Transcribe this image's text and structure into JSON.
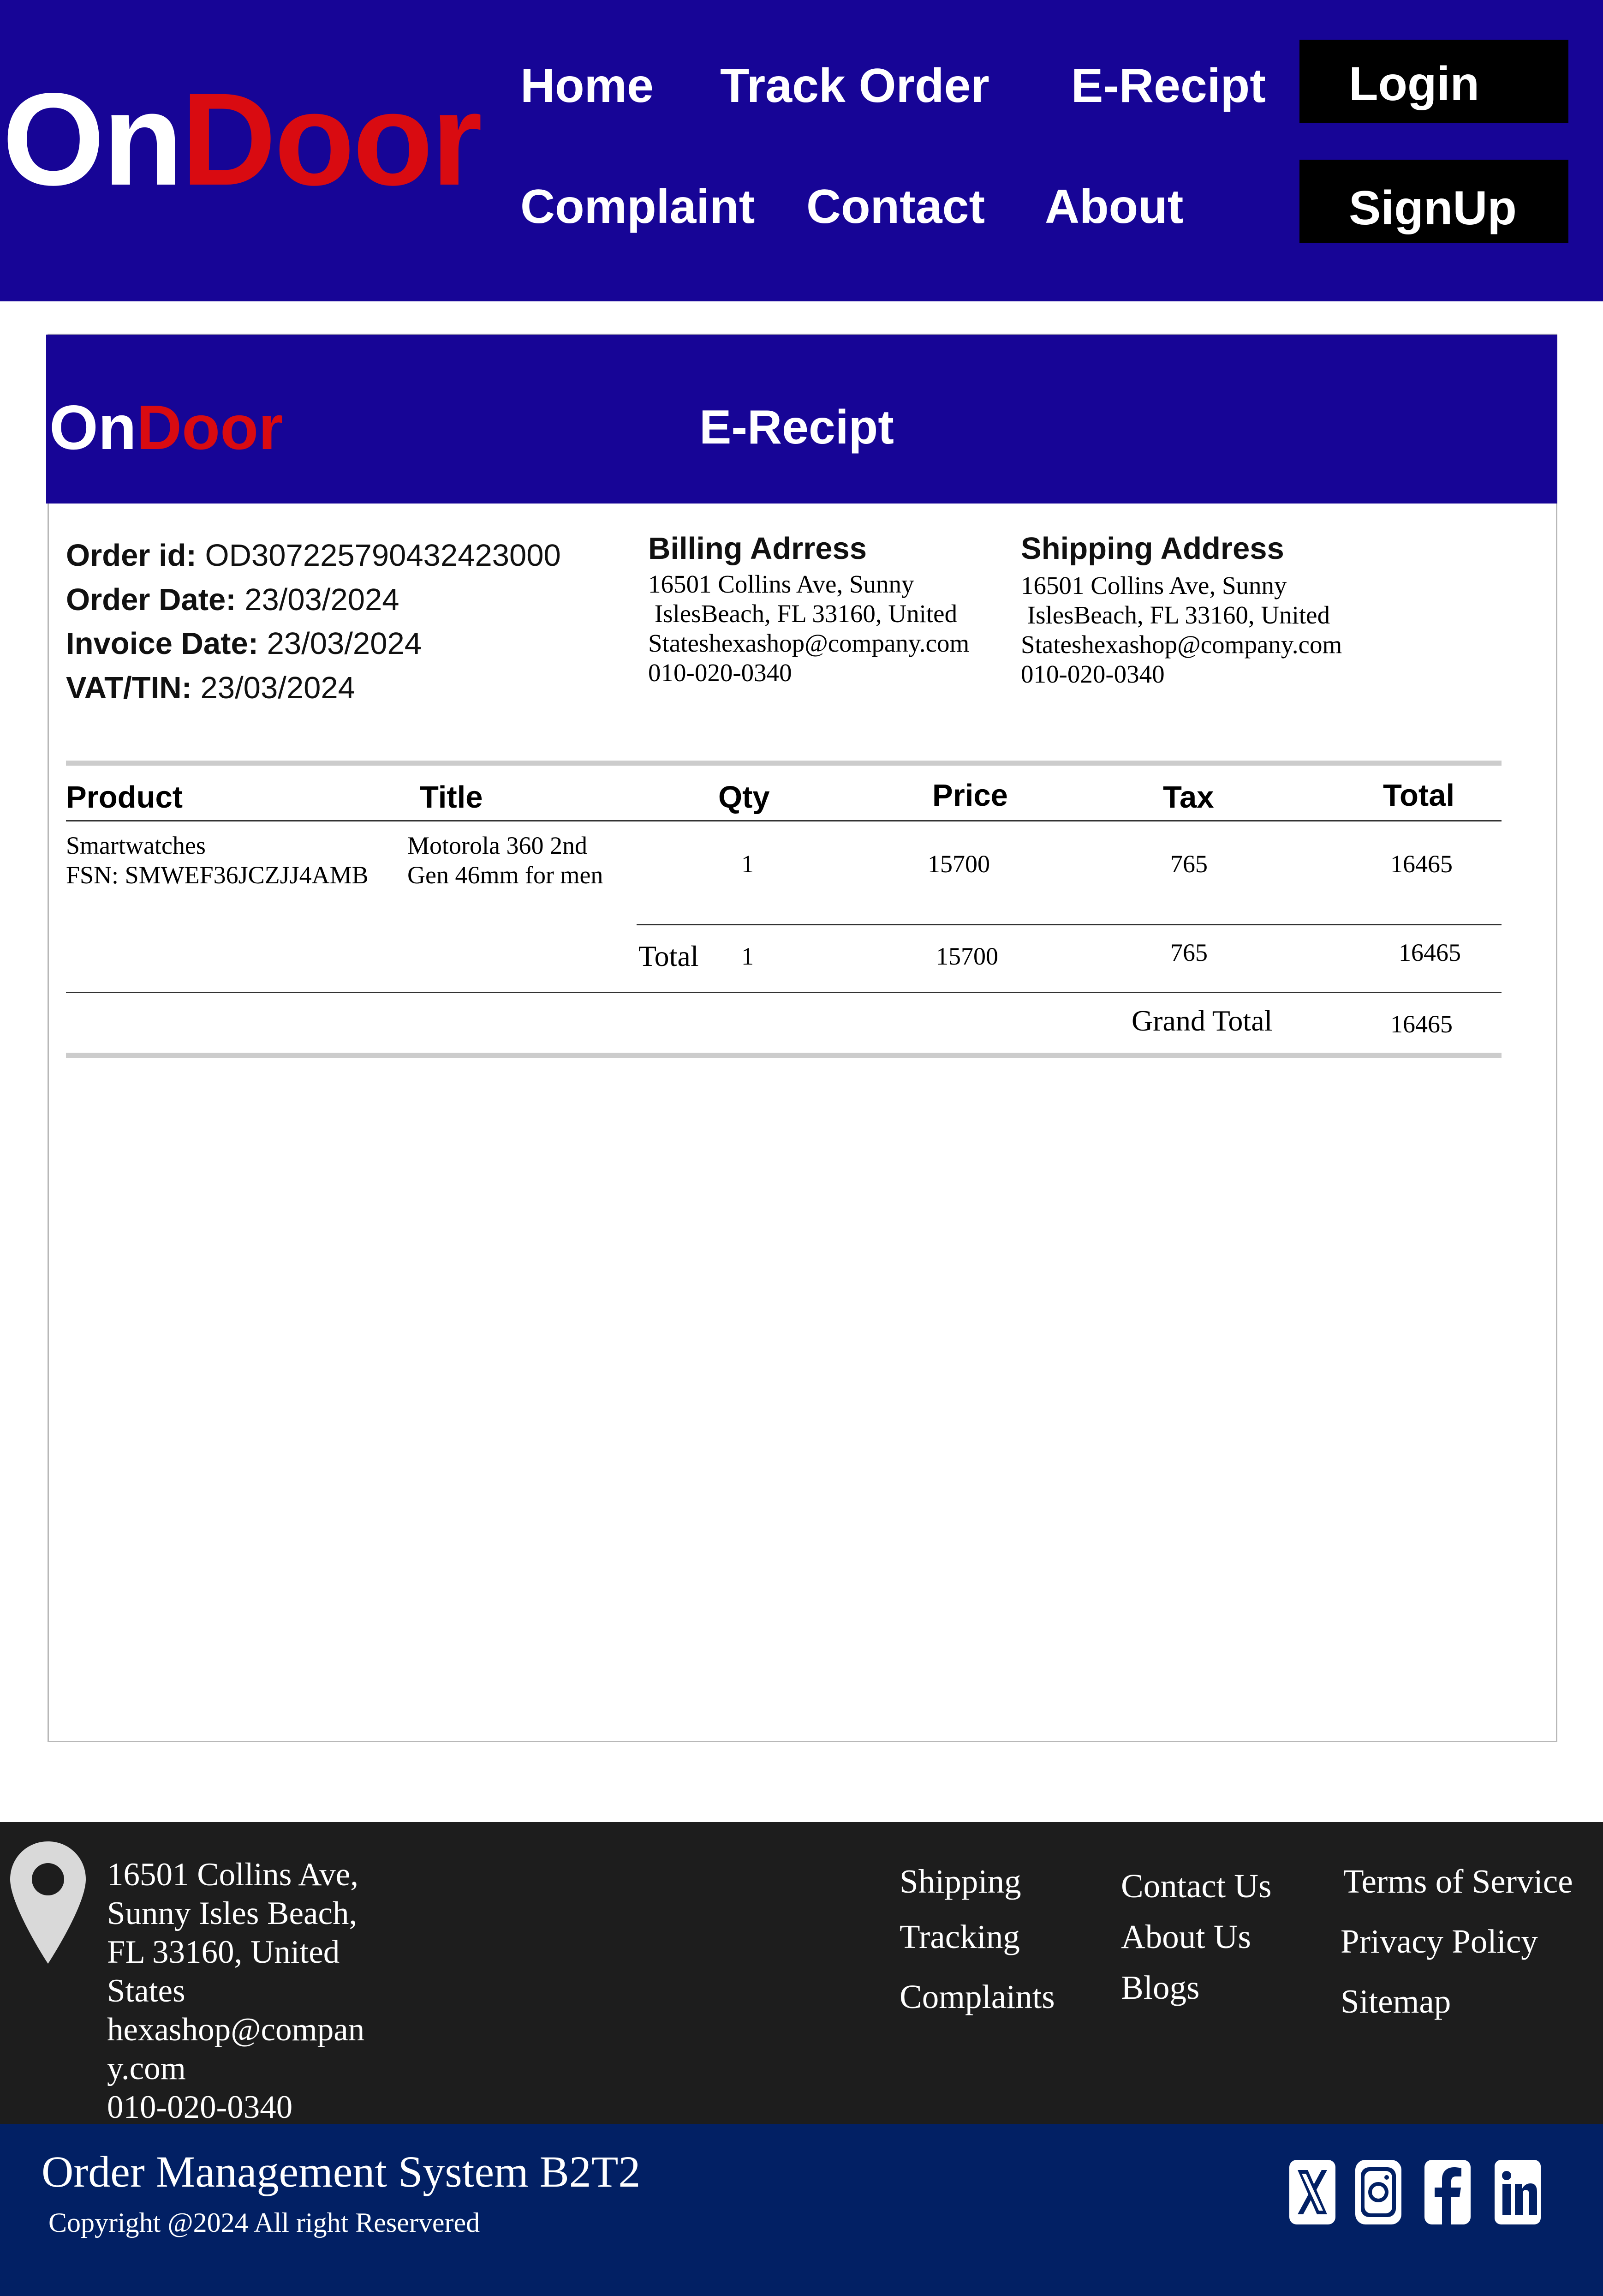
{
  "brand": {
    "part1": "On",
    "part2": "Door"
  },
  "nav": {
    "home": "Home",
    "track_order": "Track Order",
    "e_recipt": "E-Recipt",
    "complaint": "Complaint",
    "contact": "Contact",
    "about": "About",
    "login": "Login",
    "signup": "SignUp"
  },
  "receipt": {
    "title": "E-Recipt",
    "order_id_label": "Order id:",
    "order_id": "OD307225790432423000",
    "order_date_label": "Order Date:",
    "order_date": "23/03/2024",
    "invoice_date_label": "Invoice Date:",
    "invoice_date": "23/03/2024",
    "vat_label": "VAT/TIN:",
    "vat": "23/03/2024",
    "billing": {
      "heading": "Billing Adrress",
      "lines": "16501 Collins Ave, Sunny\n IslesBeach, FL 33160, United\nStateshexashop@company.com\n010-020-0340"
    },
    "shipping": {
      "heading": "Shipping Address",
      "lines": "16501 Collins Ave, Sunny\n IslesBeach, FL 33160, United\nStateshexashop@company.com\n010-020-0340"
    },
    "columns": {
      "product": "Product",
      "title": "Title",
      "qty": "Qty",
      "price": "Price",
      "tax": "Tax",
      "total": "Total"
    },
    "item": {
      "product": "Smartwatches\nFSN: SMWEF36JCZJJ4AMB",
      "title": "Motorola 360 2nd\nGen 46mm for men",
      "qty": "1",
      "price": "15700",
      "tax": "765",
      "total": "16465"
    },
    "totals": {
      "label": "Total",
      "qty": "1",
      "price": "15700",
      "tax": "765",
      "total": "16465"
    },
    "grand_total": {
      "label": "Grand Total",
      "value": "16465"
    }
  },
  "footer": {
    "address": "16501 Collins Ave,\nSunny Isles Beach,\nFL 33160, United\nStates\nhexashop@compan\ny.com\n010-020-0340",
    "links_col1": [
      "Shipping",
      "Tracking",
      "Complaints"
    ],
    "links_col2": [
      "Contact Us",
      "About Us",
      "Blogs"
    ],
    "links_col3": [
      "Terms of Service",
      "Privacy  Policy",
      "Sitemap"
    ],
    "system_name": "Order Management System B2T2",
    "copyright": "Copyright @2024 All right Reservered",
    "social_icons": [
      "x-icon",
      "instagram-icon",
      "facebook-icon",
      "linkedin-icon"
    ]
  },
  "colors": {
    "header_bg": "#170596",
    "brand_red": "#d90b11",
    "footer_bg": "#1d1d1d",
    "bottom_bar_bg": "#022064"
  }
}
